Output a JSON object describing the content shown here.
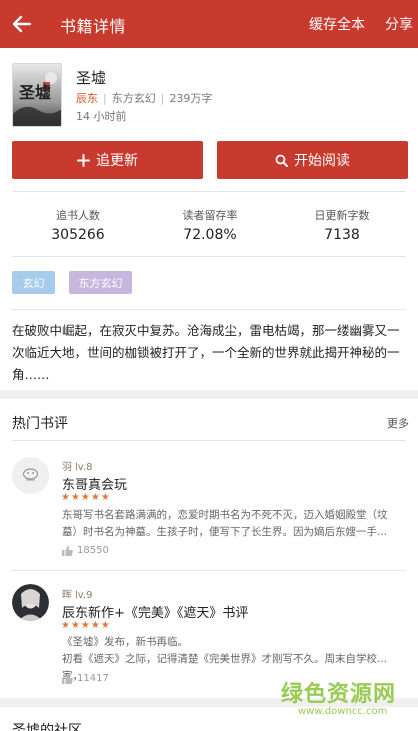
{
  "header": {
    "title": "书籍详情",
    "cache_label": "缓存全本",
    "share_label": "分享"
  },
  "book": {
    "title": "圣墟",
    "author": "辰东",
    "category": "东方玄幻",
    "word_count": "239万字",
    "updated": "14 小时前",
    "cover_text": "圣墟"
  },
  "actions": {
    "follow_label": "追更新",
    "read_label": "开始阅读"
  },
  "stats": [
    {
      "label": "追书人数",
      "value": "305266"
    },
    {
      "label": "读者留存率",
      "value": "72.08%"
    },
    {
      "label": "日更新字数",
      "value": "7138"
    }
  ],
  "tags": [
    "玄幻",
    "东方玄幻"
  ],
  "intro": "在破败中崛起，在寂灭中复苏。沧海成尘，雷电枯竭，那一缕幽雾又一次临近大地，世间的枷锁被打开了，一个全新的世界就此揭开神秘的一角……",
  "reviews_section": {
    "title": "热门书评",
    "more_label": "更多",
    "reviews": [
      {
        "user": "羽",
        "level": "lv.8",
        "stars": "★★★★★",
        "title": "东哥真会玩",
        "body": "东哥写书名套路满满的，恋爱时期书名为不死不灭，迈入婚姻殿堂（坟墓）时书名为神墓。生孩子时，便写下了长生界。因为嫡后东嫂一手...",
        "likes": "18550"
      },
      {
        "user": "晖",
        "level": "lv.9",
        "stars": "★★★★★",
        "title": "辰东新作+《完美》《遮天》书评",
        "body": "《圣墟》发布，新书再临。\n初看《遮天》之际，记得清楚《完美世界》才刚写不久。周末自学校...家，",
        "likes": "11417"
      }
    ]
  },
  "community_title": "圣墟的社区",
  "watermark": {
    "line1": "绿色资源网",
    "line2": "www.downcc.com"
  },
  "colors": {
    "brand_red": "#c8392e",
    "author_orange": "#d9531e",
    "tag_blue": "#a6cbeb",
    "tag_purple": "#c7b6dd",
    "star_orange": "#e07a3a"
  }
}
